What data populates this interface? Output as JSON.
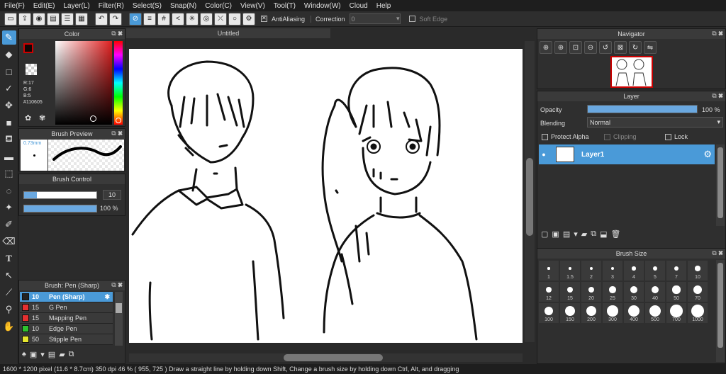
{
  "menu": [
    "File(F)",
    "Edit(E)",
    "Layer(L)",
    "Filter(R)",
    "Select(S)",
    "Snap(N)",
    "Color(C)",
    "View(V)",
    "Tool(T)",
    "Window(W)",
    "Cloud",
    "Help"
  ],
  "toolbar": {
    "antialiasing_label": "AntiAliasing",
    "correction_label": "Correction",
    "correction_value": "0",
    "soft_edge_label": "Soft Edge"
  },
  "color_panel": {
    "title": "Color",
    "r": "R:17",
    "g": "G:6",
    "b": "B:5",
    "hex": "#110605",
    "fg_color": "#110605"
  },
  "brush_preview": {
    "title": "Brush Preview",
    "size": "0.73mm"
  },
  "brush_control": {
    "title": "Brush Control",
    "size_value": "10",
    "opacity_value": "100 %",
    "opacity_fraction": 1.0
  },
  "brush_list": {
    "title": "Brush: Pen (Sharp)",
    "items": [
      {
        "size": "10",
        "name": "Pen (Sharp)",
        "color": "#222222"
      },
      {
        "size": "15",
        "name": "G Pen",
        "color": "#e53030"
      },
      {
        "size": "15",
        "name": "Mapping Pen",
        "color": "#e53030"
      },
      {
        "size": "10",
        "name": "Edge Pen",
        "color": "#2ec22e"
      },
      {
        "size": "50",
        "name": "Stipple Pen",
        "color": "#e6e62e"
      }
    ]
  },
  "document": {
    "tab_title": "Untitled"
  },
  "navigator": {
    "title": "Navigator"
  },
  "layer_panel": {
    "title": "Layer",
    "opacity_label": "Opacity",
    "opacity_value": "100 %",
    "opacity_fraction": 1.0,
    "blending_label": "Blending",
    "blending_value": "Normal",
    "protect_alpha_label": "Protect Alpha",
    "clipping_label": "Clipping",
    "lock_label": "Lock",
    "layer_name": "Layer1"
  },
  "brush_size": {
    "title": "Brush Size",
    "sizes": [
      "1",
      "1.5",
      "2",
      "3",
      "4",
      "5",
      "7",
      "10",
      "12",
      "15",
      "20",
      "25",
      "30",
      "40",
      "50",
      "70",
      "100",
      "150",
      "200",
      "300",
      "400",
      "500",
      "700",
      "1000"
    ]
  },
  "status": {
    "dimensions": "1600 * 1200 pixel",
    "physical": "(11.6 * 8.7cm)",
    "dpi": "350 dpi",
    "zoom": "46 %",
    "coords": "( 955, 725 )",
    "hint": "Draw a straight line by holding down Shift, Change a brush size by holding down Ctrl, Alt, and dragging"
  }
}
